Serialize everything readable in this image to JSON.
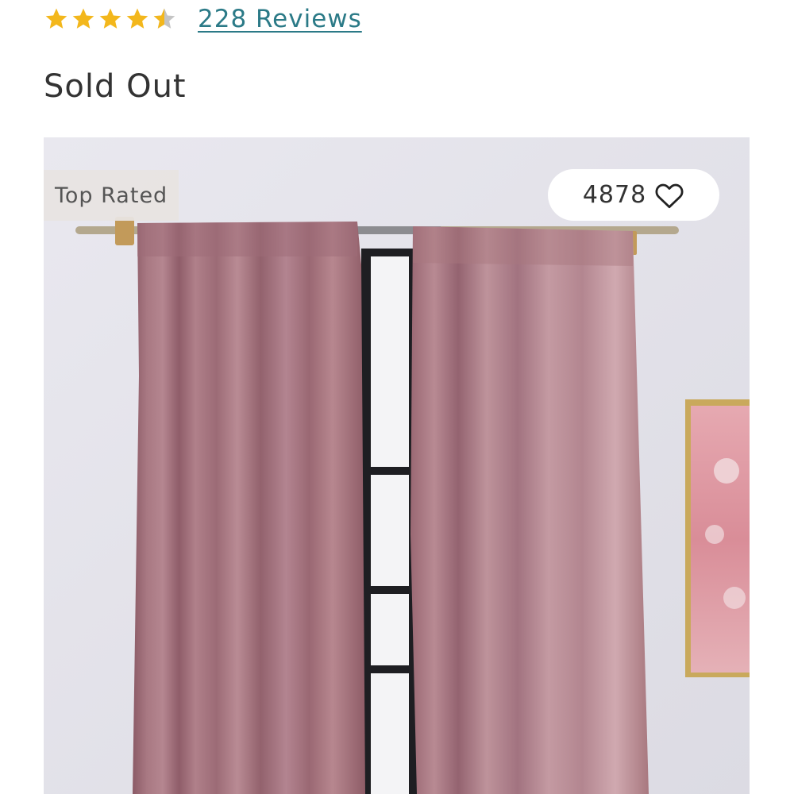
{
  "rating": {
    "value": 4.5,
    "max": 5,
    "star_color": "#f3b71c",
    "empty_color": "#c4c4c4",
    "reviews_label": "228 Reviews"
  },
  "product": {
    "status": "Sold Out",
    "image": {
      "description_icon": "product-photo",
      "badge": "Top Rated",
      "favorites_count": "4878",
      "favorite_icon": "heart-outline-icon"
    }
  }
}
